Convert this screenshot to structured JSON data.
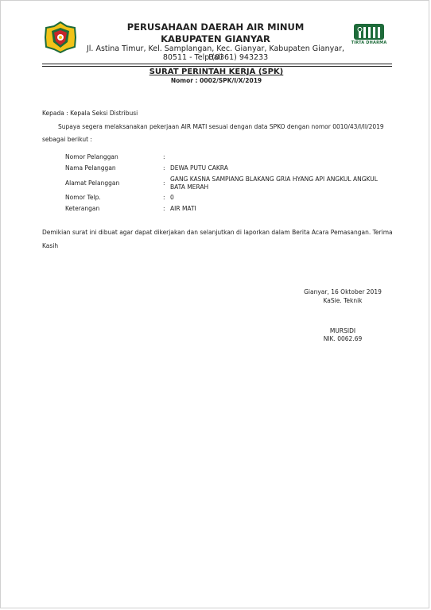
{
  "header": {
    "company_line1": "PERUSAHAAN DAERAH AIR MINUM",
    "company_line2": "KABUPATEN GIANYAR",
    "address_line1": "Jl. Astina Timur, Kel. Samplangan, Kec. Gianyar, Kabupaten Gianyar, Bali",
    "address_line2": "80511 - Telp.(0361) 943233",
    "logo_right_text": "TIRTA DHARMA"
  },
  "letter": {
    "title": "SURAT PERINTAH KERJA (SPK)",
    "number": "Nomor : 0002/SPK/I/X/2019",
    "recipient": "Kepada : Kepala Seksi Distribusi",
    "intro_line1": "Supaya segera melaksanakan pekerjaan AIR MATI sesuai dengan data SPKO dengan nomor 0010/43/I/II/2019",
    "intro_line2": "sebagai berikut :",
    "fields": [
      {
        "label": "Nomor Pelanggan",
        "colon": ":",
        "value": ""
      },
      {
        "label": "Nama Pelanggan",
        "colon": ":",
        "value": "DEWA PUTU CAKRA"
      },
      {
        "label": "Alamat Pelanggan",
        "colon": ":",
        "value": "GANG KASNA SAMPIANG BLAKANG GRIA HYANG API ANGKUL ANGKUL BATA MERAH"
      },
      {
        "label": "Nomor Telp.",
        "colon": ":",
        "value": "0"
      },
      {
        "label": "Keterangan",
        "colon": ":",
        "value": "AIR MATI"
      }
    ],
    "closing_line1": "Demikian surat ini dibuat agar dapat dikerjakan dan selanjutkan di laporkan dalam Berita Acara Pemasangan. Terima",
    "closing_line2": "Kasih"
  },
  "signature": {
    "place_date": "Gianyar, 16 Oktober 2019",
    "position": "KaSie. Teknik",
    "name": "MURSIDI",
    "nik": "NIK. 0062.69"
  },
  "colors": {
    "logo_green": "#1e6b3a",
    "logo_yellow": "#f2c318",
    "logo_red": "#c8262a",
    "text": "#222222"
  }
}
